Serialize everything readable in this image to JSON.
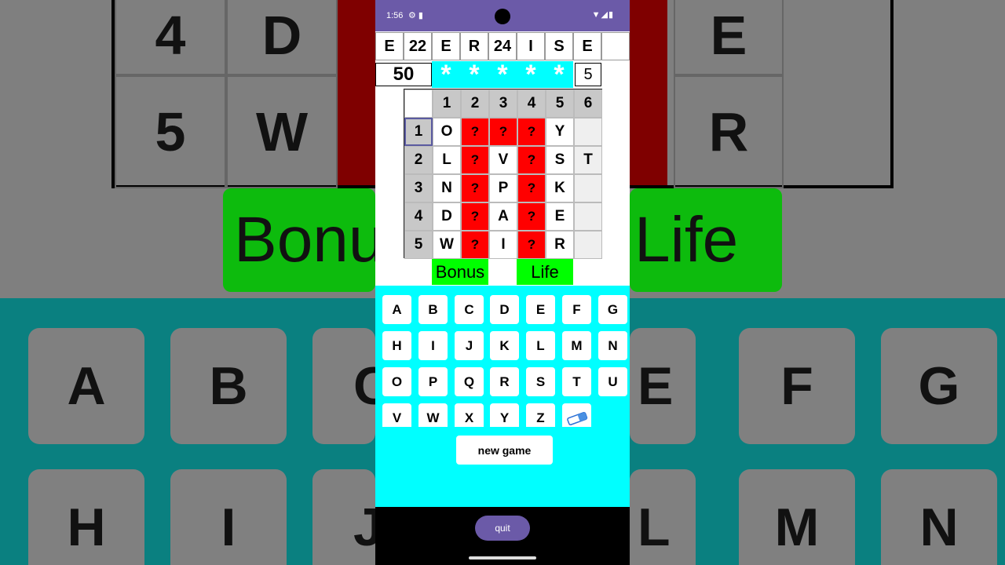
{
  "status": {
    "time": "1:56"
  },
  "word_row": [
    "E",
    "22",
    "E",
    "R",
    "24",
    "I",
    "S",
    "E",
    ""
  ],
  "score": "50",
  "stars": [
    "*",
    "*",
    "*",
    "*",
    "*"
  ],
  "lives": "5",
  "grid": {
    "col_headers": [
      "1",
      "2",
      "3",
      "4",
      "5",
      "6"
    ],
    "row_headers": [
      "1",
      "2",
      "3",
      "4",
      "5"
    ],
    "rows": [
      [
        "O",
        "?",
        "?",
        "?",
        "Y",
        ""
      ],
      [
        "L",
        "?",
        "V",
        "?",
        "S",
        "T"
      ],
      [
        "N",
        "?",
        "P",
        "?",
        "K",
        ""
      ],
      [
        "D",
        "?",
        "A",
        "?",
        "E",
        ""
      ],
      [
        "W",
        "?",
        "I",
        "?",
        "R",
        ""
      ]
    ]
  },
  "tags": {
    "bonus": "Bonus",
    "life": "Life"
  },
  "keyboard": {
    "rows": [
      [
        "A",
        "B",
        "C",
        "D",
        "E",
        "F",
        "G"
      ],
      [
        "H",
        "I",
        "J",
        "K",
        "L",
        "M",
        "N"
      ],
      [
        "O",
        "P",
        "Q",
        "R",
        "S",
        "T",
        "U"
      ],
      [
        "V",
        "W",
        "X",
        "Y",
        "Z"
      ]
    ],
    "eraser_icon": "eraser-icon"
  },
  "buttons": {
    "new_game": "new game",
    "quit": "quit"
  },
  "background": {
    "grid_cells": [
      "4",
      "D",
      "E",
      "5",
      "W",
      "R"
    ],
    "green_left": "Bonu",
    "green_right": "Life",
    "keys_row1": [
      "A",
      "B",
      "C",
      "E",
      "F",
      "G"
    ],
    "keys_row2": [
      "H",
      "I",
      "J",
      "L",
      "M",
      "N"
    ]
  },
  "colors": {
    "accent": "#6b5aa8",
    "cyan": "#00ffff",
    "red": "#ff0000",
    "green": "#00ff00"
  }
}
